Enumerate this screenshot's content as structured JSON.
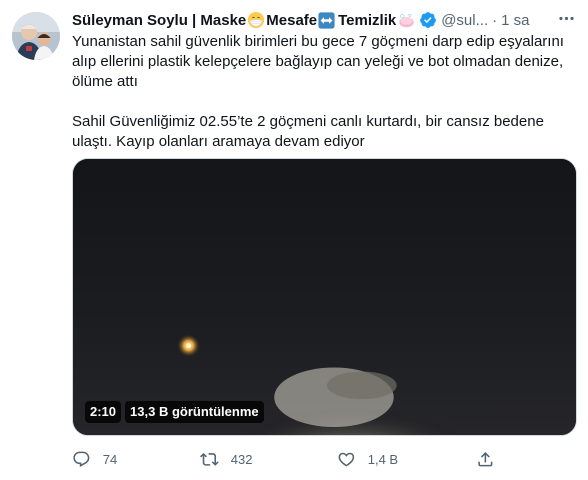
{
  "tweet": {
    "author": {
      "name_part1": "Süleyman Soylu | Maske",
      "name_part2": "Mesafe",
      "name_part3": "Temizlik",
      "handle": "@sul...",
      "time": "1 sa",
      "separator": "·"
    },
    "text_paragraph1": "Yunanistan sahil güvenlik birimleri bu gece 7 göçmeni darp edip eşyalarını alıp ellerini plastik kelepçelere bağlayıp can yeleği ve bot olmadan denize, ölüme attı",
    "text_paragraph2": "Sahil Güvenliğimiz 02.55’te 2 göçmeni canlı kurtardı, bir cansız bedene ulaştı. Kayıp olanları aramaya devam ediyor",
    "media": {
      "duration": "2:10",
      "views": "13,3 B görüntülenme"
    },
    "actions": {
      "reply_count": "74",
      "retweet_count": "432",
      "like_count": "1,4 B"
    }
  },
  "colors": {
    "text_primary": "#0f1419",
    "text_secondary": "#536471",
    "verified_blue": "#1d9bf0",
    "media_dark": "#16171a"
  },
  "icons": [
    "mask-emoji-icon",
    "left-right-arrow-emoji-icon",
    "soap-emoji-icon",
    "verified-badge-icon",
    "more-icon",
    "reply-icon",
    "retweet-icon",
    "like-icon",
    "share-icon"
  ]
}
